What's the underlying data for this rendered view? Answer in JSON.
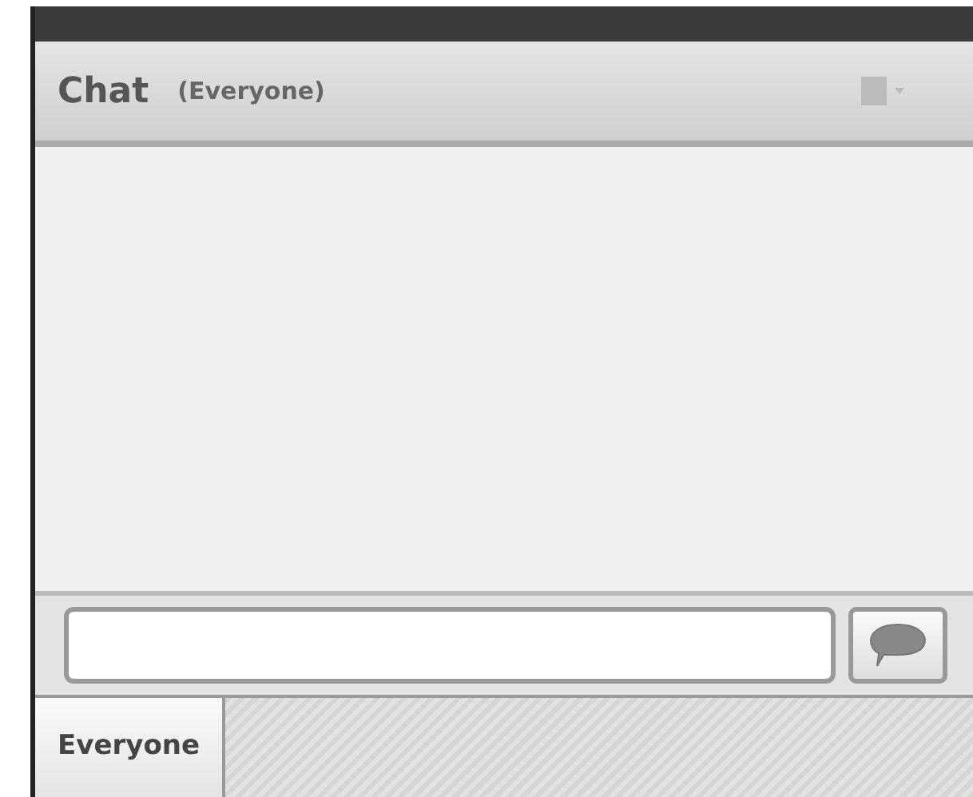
{
  "panel": {
    "title": "Chat",
    "subtitle": "(Everyone)"
  },
  "tabs": [
    {
      "label": "Everyone",
      "selected": true
    }
  ]
}
